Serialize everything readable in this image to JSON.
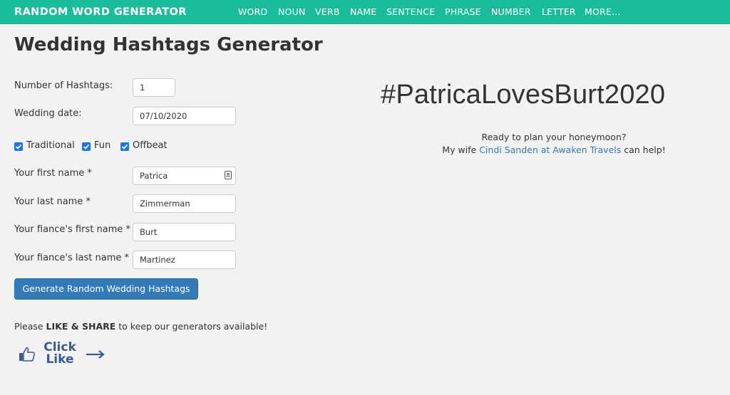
{
  "header": {
    "brand": "RANDOM WORD GENERATOR",
    "nav": [
      "WORD",
      "NOUN",
      "VERB",
      "NAME",
      "SENTENCE",
      "PHRASE",
      "NUMBER",
      "LETTER",
      "MORE..."
    ]
  },
  "page_title": "Wedding Hashtags Generator",
  "form": {
    "num_hashtags_label": "Number of Hashtags:",
    "num_hashtags_value": "1",
    "wedding_date_label": "Wedding date:",
    "wedding_date_value": "07/10/2020",
    "checkboxes": [
      {
        "label": "Traditional",
        "checked": true
      },
      {
        "label": "Fun",
        "checked": true
      },
      {
        "label": "Offbeat",
        "checked": true
      }
    ],
    "first_name_label": "Your first name *",
    "first_name_value": "Patrica",
    "last_name_label": "Your last name *",
    "last_name_value": "Zimmerman",
    "fiance_first_label": "Your fiance's first name *",
    "fiance_first_value": "Burt",
    "fiance_last_label": "Your fiance's last name *",
    "fiance_last_value": "Martinez",
    "generate_button": "Generate Random Wedding Hashtags"
  },
  "share": {
    "prefix": "Please ",
    "emphasis": "LIKE & SHARE",
    "suffix": " to keep our generators available!",
    "click": "Click",
    "like": "Like"
  },
  "result": {
    "hashtag": "#PatricaLovesBurt2020",
    "promo_line1": "Ready to plan your honeymoon?",
    "promo_prefix": "My wife ",
    "promo_link": "Cindi Sanden at Awaken Travels",
    "promo_suffix": " can help!"
  },
  "colors": {
    "header_bg": "#1abc9c",
    "button_bg": "#337ab7",
    "link": "#337ab7",
    "checkbox": "#1a73e8",
    "like_blue": "#3b5998"
  },
  "icons": [
    "thumbs-up-icon",
    "arrow-right-icon",
    "contact-card-icon",
    "checkmark-icon"
  ]
}
